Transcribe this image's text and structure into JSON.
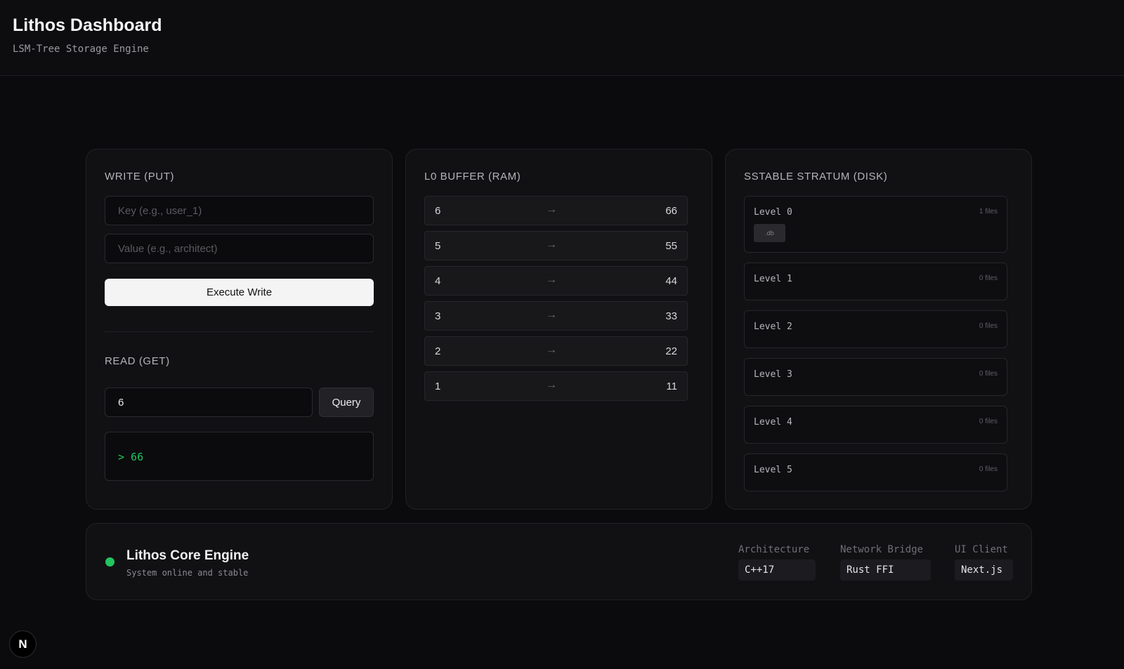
{
  "header": {
    "title": "Lithos Dashboard",
    "subtitle": "LSM-Tree Storage Engine"
  },
  "write": {
    "label": "WRITE (PUT)",
    "key_placeholder": "Key (e.g., user_1)",
    "value_placeholder": "Value (e.g., architect)",
    "button": "Execute Write"
  },
  "read": {
    "label": "READ (GET)",
    "query_value": "6",
    "button": "Query",
    "result": "> 66"
  },
  "buffer": {
    "label": "L0 BUFFER (RAM)",
    "arrow": "→",
    "rows": [
      {
        "key": "6",
        "value": "66"
      },
      {
        "key": "5",
        "value": "55"
      },
      {
        "key": "4",
        "value": "44"
      },
      {
        "key": "3",
        "value": "33"
      },
      {
        "key": "2",
        "value": "22"
      },
      {
        "key": "1",
        "value": "11"
      }
    ]
  },
  "sstable": {
    "label": "SSTABLE STRATUM (DISK)",
    "levels": [
      {
        "name": "Level 0",
        "count": "1 files",
        "file": ".db"
      },
      {
        "name": "Level 1",
        "count": "0 files"
      },
      {
        "name": "Level 2",
        "count": "0 files"
      },
      {
        "name": "Level 3",
        "count": "0 files"
      },
      {
        "name": "Level 4",
        "count": "0 files"
      },
      {
        "name": "Level 5",
        "count": "0 files"
      }
    ]
  },
  "footer": {
    "status_color": "#22c55e",
    "engine_name": "Lithos Core Engine",
    "engine_status": "System online and stable",
    "stack": [
      {
        "label": "Architecture",
        "value": "C++17"
      },
      {
        "label": "Network Bridge",
        "value": "Rust FFI"
      },
      {
        "label": "UI Client",
        "value": "Next.js"
      }
    ]
  },
  "badge": {
    "letter": "N"
  }
}
